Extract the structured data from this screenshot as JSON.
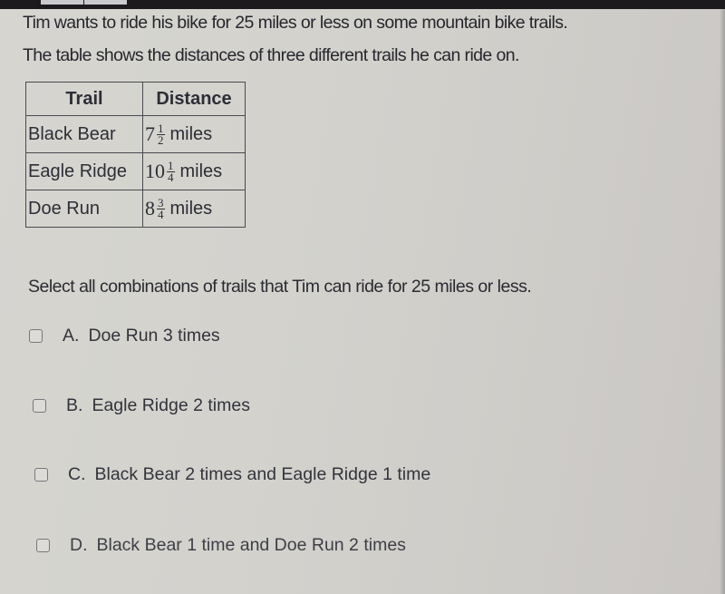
{
  "question": {
    "prompt_line1": "Tim wants to ride his bike for 25 miles or less on some mountain bike trails.",
    "prompt_line2": "The table shows the distances of three different trails he can ride on.",
    "instruction": "Select all combinations of trails that Tim can ride for 25 miles or less."
  },
  "table": {
    "headers": [
      "Trail",
      "Distance"
    ],
    "rows": [
      {
        "trail": "Black Bear",
        "whole": "7",
        "numerator": "1",
        "denominator": "2",
        "unit": "miles"
      },
      {
        "trail": "Eagle Ridge",
        "whole": "10",
        "numerator": "1",
        "denominator": "4",
        "unit": "miles"
      },
      {
        "trail": "Doe Run",
        "whole": "8",
        "numerator": "3",
        "denominator": "4",
        "unit": "miles"
      }
    ]
  },
  "options": [
    {
      "letter": "A.",
      "text": "Doe Run 3 times",
      "checked": false
    },
    {
      "letter": "B.",
      "text": "Eagle Ridge 2 times",
      "checked": false
    },
    {
      "letter": "C.",
      "text": "Black Bear 2 times and Eagle Ridge 1 time",
      "checked": false
    },
    {
      "letter": "D.",
      "text": "Black Bear 1 time and Doe Run 2 times",
      "checked": false
    }
  ]
}
